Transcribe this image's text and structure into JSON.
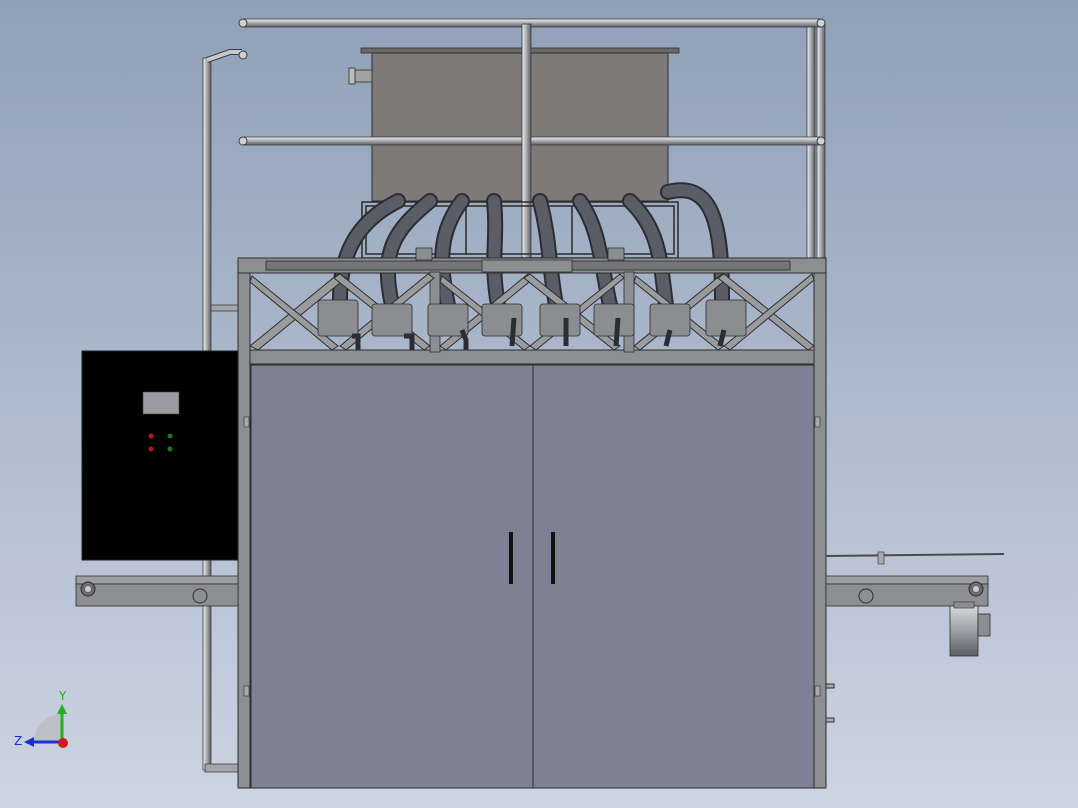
{
  "view": {
    "axis_triad": {
      "y_label": "Y",
      "z_label": "Z",
      "colors": {
        "y": "#1db31d",
        "z": "#1b2fd8",
        "x": "#d11a1a"
      }
    }
  },
  "colors": {
    "background_top": "#8fa0b8",
    "background_bottom": "#cdd4e2",
    "frame_steel": "#8d8e92",
    "cabinet_door": "#7d8192",
    "tank": "#7e7a78",
    "control_box": "#000000",
    "hose": "#4a4d54"
  },
  "icons": {
    "control_box_leds": [
      "red-led",
      "green-led",
      "red-led",
      "green-led"
    ]
  }
}
